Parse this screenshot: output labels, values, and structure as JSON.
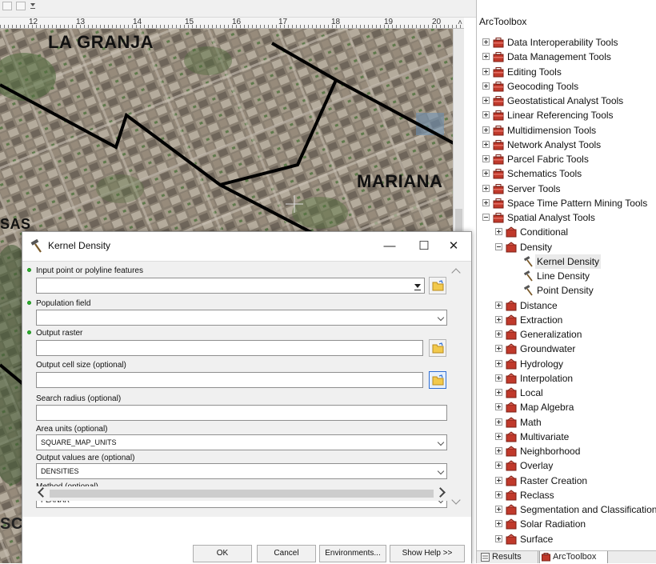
{
  "map": {
    "ruler_labels": [
      "12",
      "13",
      "14",
      "15",
      "16",
      "17",
      "18",
      "19",
      "20"
    ],
    "labels": {
      "la_granja": "LA GRANJA",
      "mariana": "MARIANA",
      "left_partial_top": "SAS",
      "left_partial_bottom": "SC"
    }
  },
  "dialog": {
    "title": "Kernel Density",
    "icon": "hammer-icon",
    "params": {
      "input_features": {
        "label": "Input point or polyline features",
        "value": "",
        "required": true
      },
      "population_field": {
        "label": "Population field",
        "value": "",
        "required": true
      },
      "output_raster": {
        "label": "Output raster",
        "value": "",
        "required": true
      },
      "cell_size": {
        "label": "Output cell size (optional)",
        "value": ""
      },
      "search_radius": {
        "label": "Search radius (optional)",
        "value": ""
      },
      "area_units": {
        "label": "Area units (optional)",
        "value": "SQUARE_MAP_UNITS"
      },
      "output_values": {
        "label": "Output values are (optional)",
        "value": "DENSITIES"
      },
      "method": {
        "label": "Method (optional)",
        "value": "PLANAR"
      }
    },
    "buttons": {
      "ok": "OK",
      "cancel": "Cancel",
      "environments": "Environments...",
      "show_help": "Show Help >>"
    }
  },
  "toolbox": {
    "title": "ArcToolbox",
    "items": [
      {
        "label": "Data Interoperability Tools",
        "level": 0,
        "expanded": false,
        "icon": "toolbox-icon"
      },
      {
        "label": "Data Management Tools",
        "level": 0,
        "expanded": false,
        "icon": "toolbox-icon"
      },
      {
        "label": "Editing Tools",
        "level": 0,
        "expanded": false,
        "icon": "toolbox-icon"
      },
      {
        "label": "Geocoding Tools",
        "level": 0,
        "expanded": false,
        "icon": "toolbox-icon"
      },
      {
        "label": "Geostatistical Analyst Tools",
        "level": 0,
        "expanded": false,
        "icon": "toolbox-icon"
      },
      {
        "label": "Linear Referencing Tools",
        "level": 0,
        "expanded": false,
        "icon": "toolbox-icon"
      },
      {
        "label": "Multidimension Tools",
        "level": 0,
        "expanded": false,
        "icon": "toolbox-icon"
      },
      {
        "label": "Network Analyst Tools",
        "level": 0,
        "expanded": false,
        "icon": "toolbox-icon"
      },
      {
        "label": "Parcel Fabric Tools",
        "level": 0,
        "expanded": false,
        "icon": "toolbox-icon"
      },
      {
        "label": "Schematics Tools",
        "level": 0,
        "expanded": false,
        "icon": "toolbox-icon"
      },
      {
        "label": "Server Tools",
        "level": 0,
        "expanded": false,
        "icon": "toolbox-icon"
      },
      {
        "label": "Space Time Pattern Mining Tools",
        "level": 0,
        "expanded": false,
        "icon": "toolbox-icon"
      },
      {
        "label": "Spatial Analyst Tools",
        "level": 0,
        "expanded": true,
        "icon": "toolbox-icon"
      },
      {
        "label": "Conditional",
        "level": 1,
        "expanded": false,
        "icon": "toolset-icon"
      },
      {
        "label": "Density",
        "level": 1,
        "expanded": true,
        "icon": "toolset-icon"
      },
      {
        "label": "Kernel Density",
        "level": 2,
        "icon": "hammer-icon",
        "selected": true
      },
      {
        "label": "Line Density",
        "level": 2,
        "icon": "hammer-icon"
      },
      {
        "label": "Point Density",
        "level": 2,
        "icon": "hammer-icon"
      },
      {
        "label": "Distance",
        "level": 1,
        "expanded": false,
        "icon": "toolset-icon"
      },
      {
        "label": "Extraction",
        "level": 1,
        "expanded": false,
        "icon": "toolset-icon"
      },
      {
        "label": "Generalization",
        "level": 1,
        "expanded": false,
        "icon": "toolset-icon"
      },
      {
        "label": "Groundwater",
        "level": 1,
        "expanded": false,
        "icon": "toolset-icon"
      },
      {
        "label": "Hydrology",
        "level": 1,
        "expanded": false,
        "icon": "toolset-icon"
      },
      {
        "label": "Interpolation",
        "level": 1,
        "expanded": false,
        "icon": "toolset-icon"
      },
      {
        "label": "Local",
        "level": 1,
        "expanded": false,
        "icon": "toolset-icon"
      },
      {
        "label": "Map Algebra",
        "level": 1,
        "expanded": false,
        "icon": "toolset-icon"
      },
      {
        "label": "Math",
        "level": 1,
        "expanded": false,
        "icon": "toolset-icon"
      },
      {
        "label": "Multivariate",
        "level": 1,
        "expanded": false,
        "icon": "toolset-icon"
      },
      {
        "label": "Neighborhood",
        "level": 1,
        "expanded": false,
        "icon": "toolset-icon"
      },
      {
        "label": "Overlay",
        "level": 1,
        "expanded": false,
        "icon": "toolset-icon"
      },
      {
        "label": "Raster Creation",
        "level": 1,
        "expanded": false,
        "icon": "toolset-icon"
      },
      {
        "label": "Reclass",
        "level": 1,
        "expanded": false,
        "icon": "toolset-icon"
      },
      {
        "label": "Segmentation and Classification",
        "level": 1,
        "expanded": false,
        "icon": "toolset-icon"
      },
      {
        "label": "Solar Radiation",
        "level": 1,
        "expanded": false,
        "icon": "toolset-icon"
      },
      {
        "label": "Surface",
        "level": 1,
        "expanded": false,
        "icon": "toolset-icon"
      }
    ],
    "tabs": [
      {
        "label": "Results",
        "icon": "results-icon",
        "active": false
      },
      {
        "label": "ArcToolbox",
        "icon": "toolbox-icon",
        "active": true
      }
    ]
  },
  "colors": {
    "toolbox_red": "#c0392b",
    "required_green": "#2db52d",
    "focus_blue": "#2f6fd4"
  }
}
